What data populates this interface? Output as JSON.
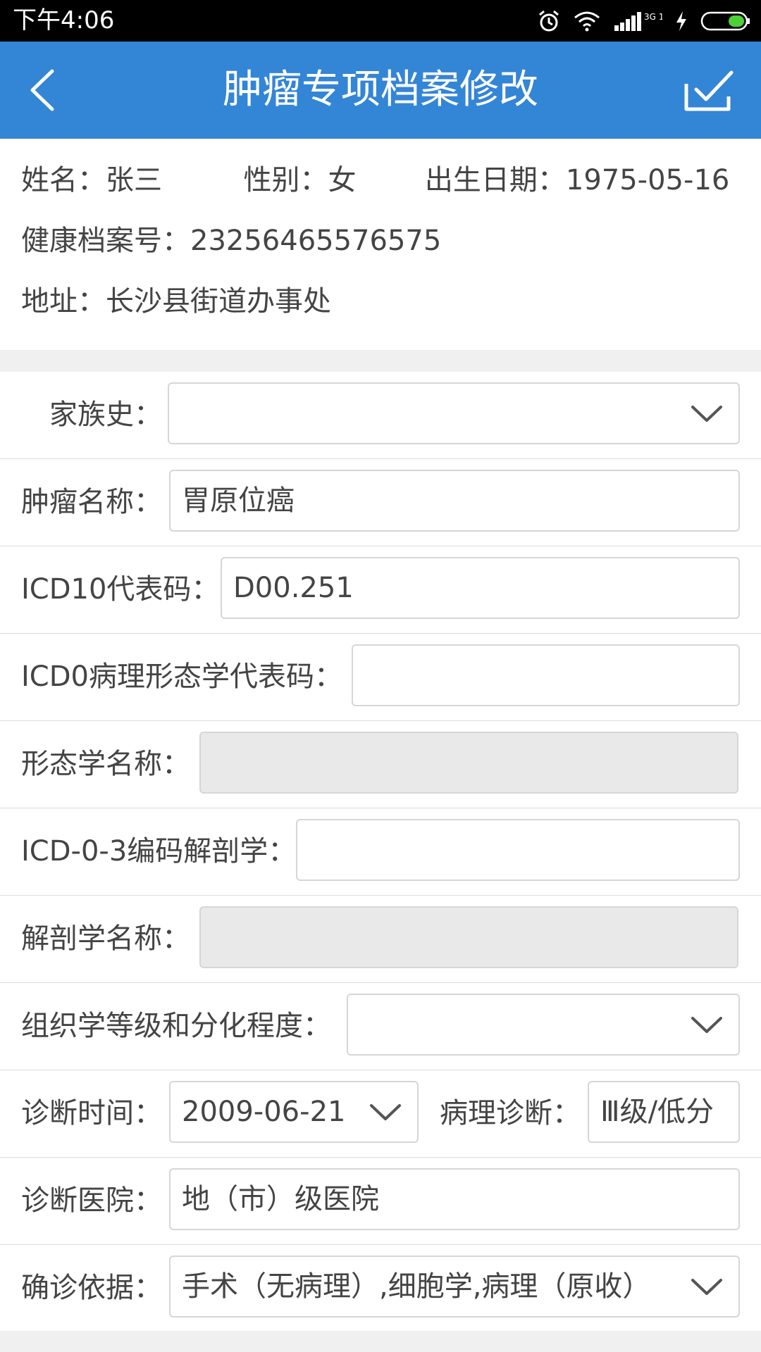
{
  "status_bar": {
    "time": "下午4:06",
    "network": "3G 1X",
    "icons": [
      "alarm-icon",
      "wifi-icon",
      "signal-icon",
      "charging-icon",
      "battery-icon"
    ],
    "battery_color": "#4cd137"
  },
  "app_bar": {
    "title": "肿瘤专项档案修改",
    "back_icon": "back-arrow-icon",
    "confirm_icon": "checkbox-check-icon",
    "color": "#3385d6"
  },
  "patient": {
    "name_label": "姓名：",
    "name": "张三",
    "gender_label": "性别：",
    "gender": "女",
    "birth_label": "出生日期：",
    "birth": "1975-05-16",
    "record_label": "健康档案号：",
    "record_no": "23256465576575",
    "address_label": "地址：",
    "address": "长沙县街道办事处"
  },
  "form": {
    "family_history": {
      "label": "家族史：",
      "value": ""
    },
    "tumor_name": {
      "label": "肿瘤名称：",
      "value": "胃原位癌"
    },
    "icd10": {
      "label": "ICD10代表码：",
      "value": "D00.251"
    },
    "icdo_morph_code": {
      "label": "ICD0病理形态学代表码：",
      "value": ""
    },
    "morph_name": {
      "label": "形态学名称：",
      "value": ""
    },
    "icdo3_anatomy": {
      "label": "ICD-0-3编码解剖学：",
      "value": ""
    },
    "anatomy_name": {
      "label": "解剖学名称：",
      "value": ""
    },
    "histology_grade": {
      "label": "组织学等级和分化程度：",
      "value": ""
    },
    "diagnosis_date": {
      "label": "诊断时间：",
      "value": "2009-06-21"
    },
    "pathology_diag": {
      "label": "病理诊断：",
      "value": "Ⅲ级/低分"
    },
    "diagnosis_hospital": {
      "label": "诊断医院：",
      "value": "地（市）级医院"
    },
    "diagnosis_basis": {
      "label": "确诊依据：",
      "value": "手术（无病理）,细胞学,病理（原收）"
    }
  }
}
